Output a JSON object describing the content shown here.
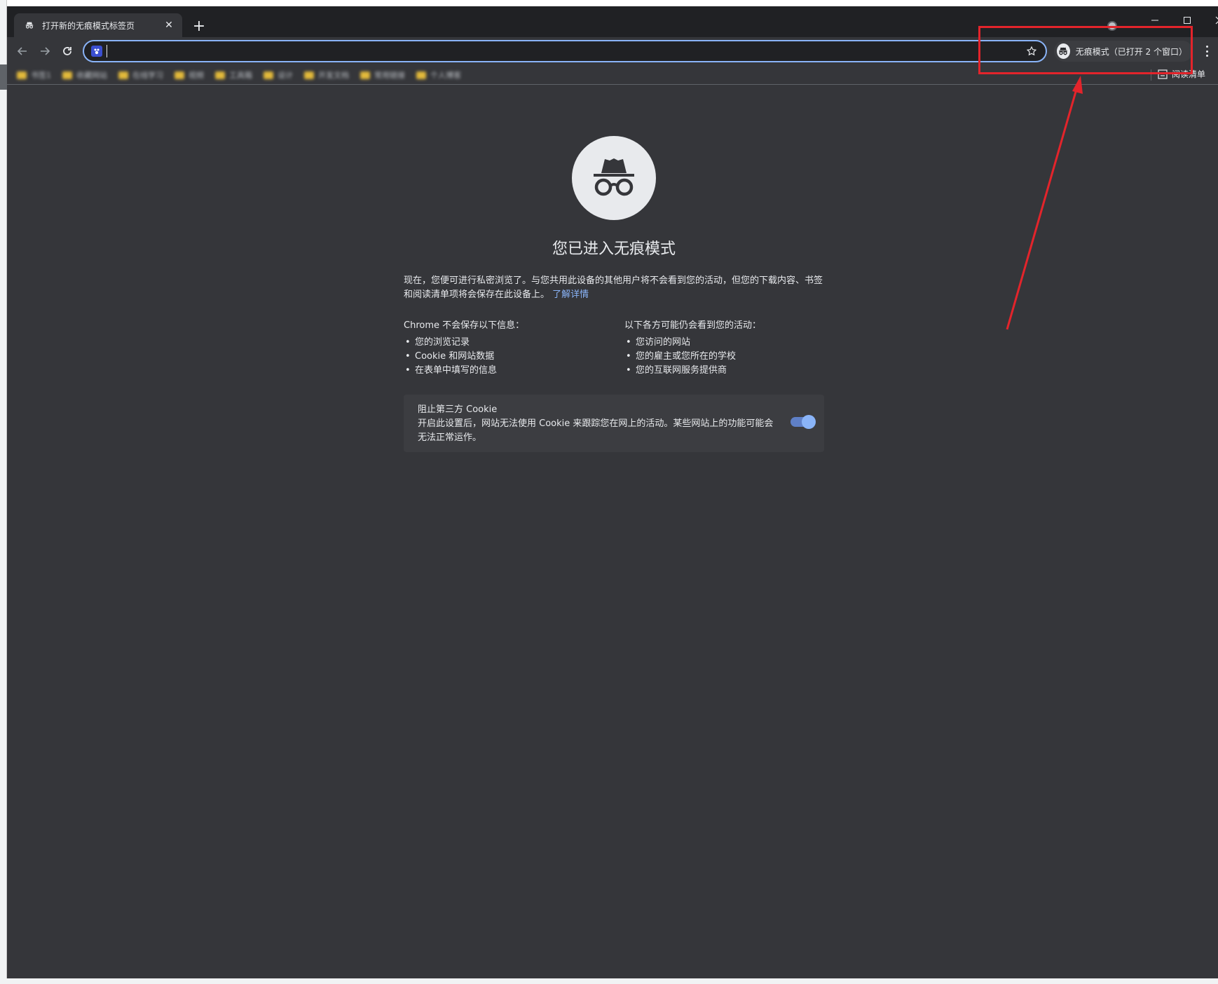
{
  "tab": {
    "title": "打开新的无痕模式标签页",
    "close_glyph": "✕",
    "new_tab_glyph": "+"
  },
  "window_controls": {
    "minimize": "—",
    "maximize": "☐",
    "close": "✕"
  },
  "toolbar": {
    "back_glyph": "←",
    "forward_glyph": "→",
    "reload_glyph": "↻",
    "address_value": "",
    "incognito_chip_label": "无痕模式（已打开 2 个窗口）",
    "star_glyph": "☆"
  },
  "bookmarks": {
    "items": [
      {
        "label": "书签1"
      },
      {
        "label": "收藏网站"
      },
      {
        "label": "在线学习"
      },
      {
        "label": "视频"
      },
      {
        "label": "工具箱"
      },
      {
        "label": "设计"
      },
      {
        "label": "开发文档"
      },
      {
        "label": "常用链接"
      },
      {
        "label": "个人博客"
      }
    ],
    "reading_list_label": "阅读清单"
  },
  "ntp": {
    "title": "您已进入无痕模式",
    "intro_text": "现在，您便可进行私密浏览了。与您共用此设备的其他用户将不会看到您的活动，但您的下载内容、书签和阅读清单项将会保存在此设备上。",
    "learn_more": "了解详情",
    "left_heading": "Chrome 不会保存以下信息：",
    "left_items": [
      "您的浏览记录",
      "Cookie 和网站数据",
      "在表单中填写的信息"
    ],
    "right_heading": "以下各方可能仍会看到您的活动：",
    "right_items": [
      "您访问的网站",
      "您的雇主或您所在的学校",
      "您的互联网服务提供商"
    ],
    "cookie_title": "阻止第三方 Cookie",
    "cookie_desc": "开启此设置后，网站无法使用 Cookie 来跟踪您在网上的活动。某些网站上的功能可能会无法正常运作。",
    "cookie_toggle_on": true
  },
  "colors": {
    "frame": "#202124",
    "background": "#35363a",
    "accent": "#8ab4f8",
    "annotation": "#e3242b"
  }
}
